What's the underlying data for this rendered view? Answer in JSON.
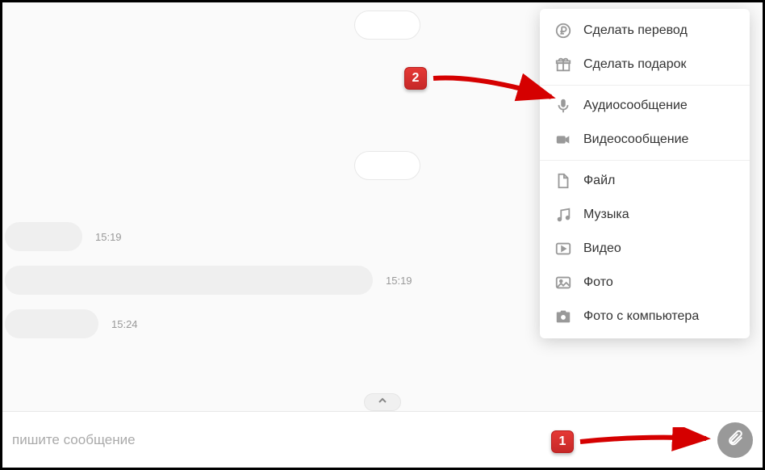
{
  "chat": {
    "messages": [
      {
        "time": "15:19"
      },
      {
        "time": "15:19"
      },
      {
        "time": "15:24"
      }
    ],
    "input_placeholder": "пишите сообщение"
  },
  "attach_menu": {
    "group1": [
      {
        "label": "Сделать перевод",
        "icon": "ruble"
      },
      {
        "label": "Сделать подарок",
        "icon": "gift"
      }
    ],
    "group2": [
      {
        "label": "Аудиосообщение",
        "icon": "mic"
      },
      {
        "label": "Видеосообщение",
        "icon": "video"
      }
    ],
    "group3": [
      {
        "label": "Файл",
        "icon": "file"
      },
      {
        "label": "Музыка",
        "icon": "music"
      },
      {
        "label": "Видео",
        "icon": "play"
      },
      {
        "label": "Фото",
        "icon": "image"
      },
      {
        "label": "Фото с компьютера",
        "icon": "camera"
      }
    ]
  },
  "callouts": {
    "step1": "1",
    "step2": "2"
  }
}
